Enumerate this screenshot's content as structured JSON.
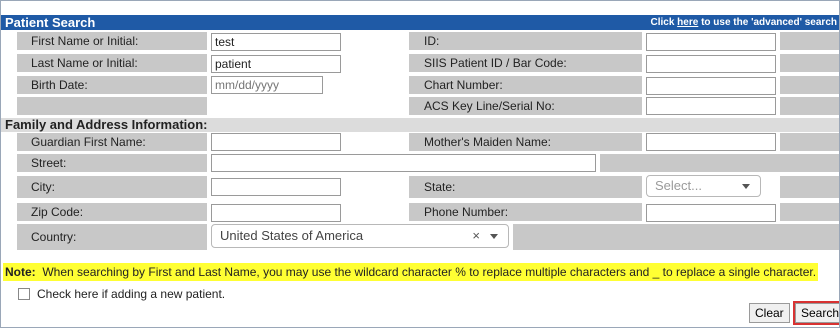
{
  "header": {
    "title": "Patient Search",
    "advanced_link_pre": "Click ",
    "advanced_link_here": "here",
    "advanced_link_post": " to use the 'advanced' search"
  },
  "form": {
    "first_name_label": "First Name or Initial:",
    "first_name_value": "test",
    "last_name_label": "Last Name or Initial:",
    "last_name_value": "patient",
    "birth_date_label": "Birth Date:",
    "birth_date_placeholder": "mm/dd/yyyy",
    "id_label": "ID:",
    "siis_label": "SIIS Patient ID / Bar Code:",
    "chart_label": "Chart Number:",
    "acs_label": "ACS Key Line/Serial No:"
  },
  "family": {
    "section_title": "Family and Address Information:",
    "guardian_label": "Guardian First Name:",
    "maiden_label": "Mother's Maiden Name:",
    "street_label": "Street:",
    "city_label": "City:",
    "state_label": "State:",
    "state_placeholder": "Select...",
    "zip_label": "Zip Code:",
    "phone_label": "Phone Number:",
    "country_label": "Country:",
    "country_value": "United States of America",
    "clear_x": "×"
  },
  "note": {
    "prefix": "Note:",
    "text": "  When searching by First and Last Name, you may use the wildcard character % to replace multiple characters and _ to replace a single character."
  },
  "new_patient_label": "Check here if adding a new patient.",
  "buttons": {
    "clear": "Clear",
    "search": "Search"
  }
}
